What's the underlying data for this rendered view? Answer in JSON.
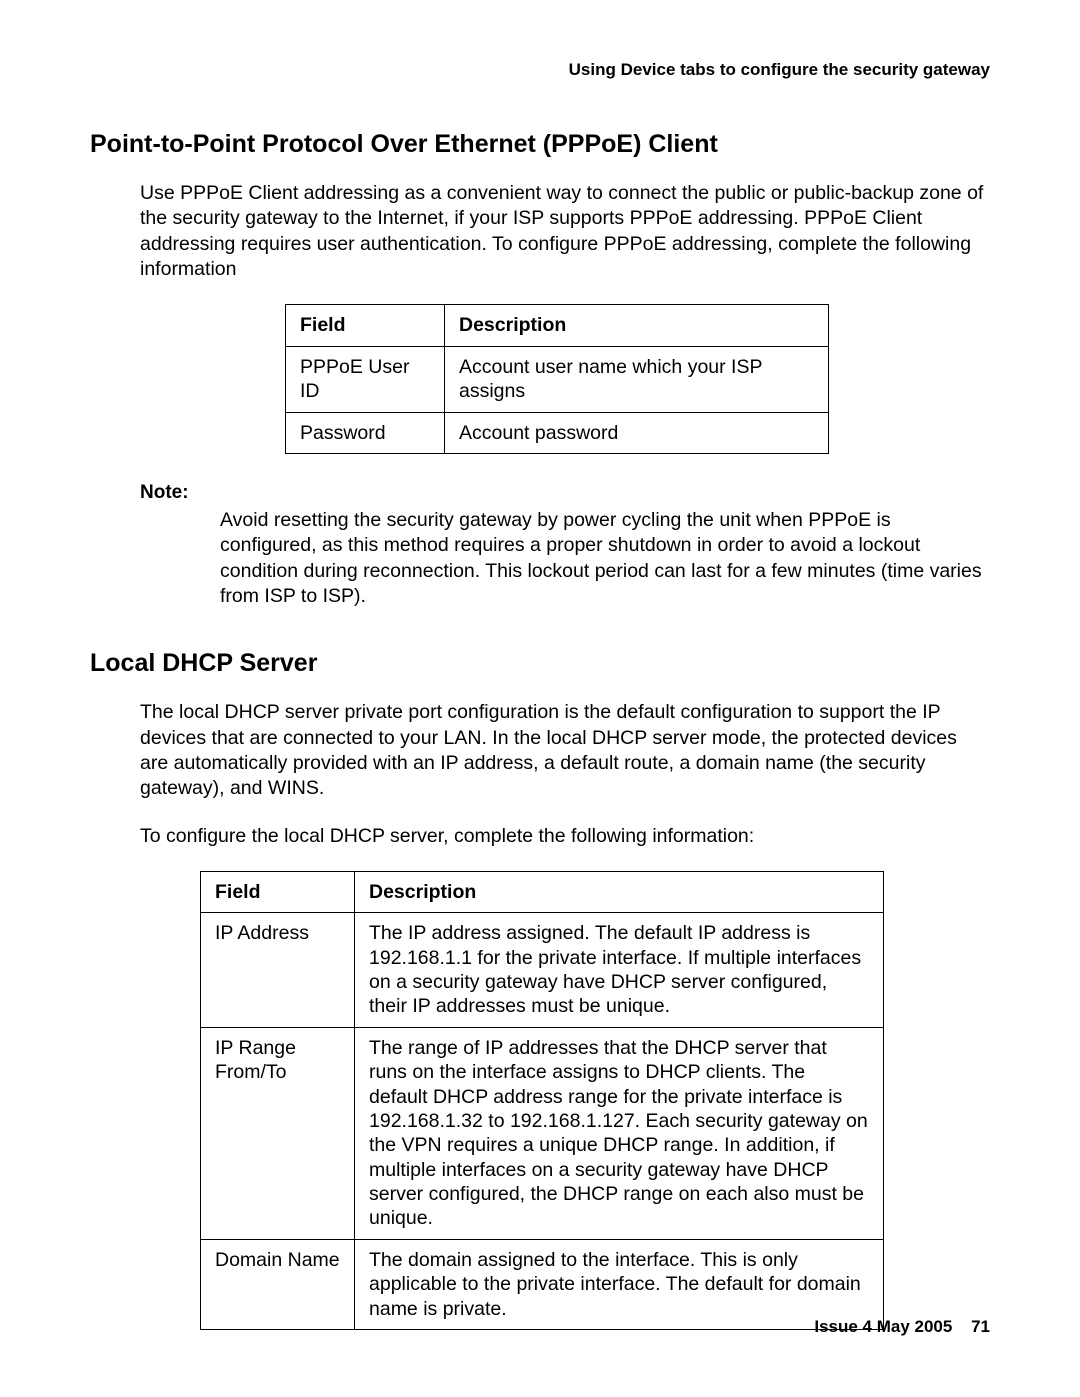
{
  "running_head": "Using Device tabs to configure the security gateway",
  "section1": {
    "title": "Point-to-Point Protocol Over Ethernet (PPPoE) Client",
    "intro": "Use PPPoE Client addressing as a convenient way to connect the public or public-backup zone of the security gateway to the Internet, if your ISP supports PPPoE addressing. PPPoE Client addressing requires user authentication. To configure PPPoE addressing, complete the following information",
    "table": {
      "headers": {
        "field": "Field",
        "desc": "Description"
      },
      "rows": [
        {
          "field": "PPPoE User ID",
          "desc": "Account user name which your ISP assigns"
        },
        {
          "field": "Password",
          "desc": "Account password"
        }
      ]
    },
    "note": {
      "label": "Note:",
      "body": "Avoid resetting the security gateway by power cycling the unit when PPPoE is configured, as this method requires a proper shutdown in order to avoid a lockout condition during reconnection. This lockout period can last for a few minutes (time varies from ISP to ISP)."
    }
  },
  "section2": {
    "title": "Local DHCP Server",
    "para1": "The local DHCP server private port configuration is the default configuration to support the IP devices that are connected to your LAN. In the local DHCP server mode, the protected devices are automatically provided with an IP address, a default route, a domain name (the security gateway), and WINS.",
    "para2": "To configure the local DHCP server, complete the following information:",
    "table": {
      "headers": {
        "field": "Field",
        "desc": "Description"
      },
      "rows": [
        {
          "field": "IP Address",
          "desc": "The IP address assigned. The default IP address is 192.168.1.1 for the private interface. If multiple interfaces on a security gateway have DHCP server configured, their IP addresses must be unique."
        },
        {
          "field": "IP Range From/To",
          "desc": "The range of IP addresses that the DHCP server that runs on the interface assigns to DHCP clients. The default DHCP address range for the private interface is 192.168.1.32 to 192.168.1.127. Each security gateway on the VPN requires a unique DHCP range. In addition, if multiple interfaces on a security gateway have DHCP server configured, the DHCP range on each also must be unique."
        },
        {
          "field": "Domain Name",
          "desc": "The domain assigned to the interface. This is only applicable to the private interface. The default for domain name is  private."
        }
      ]
    }
  },
  "footer": {
    "issue": "Issue 4   May 2005",
    "page": "71"
  }
}
